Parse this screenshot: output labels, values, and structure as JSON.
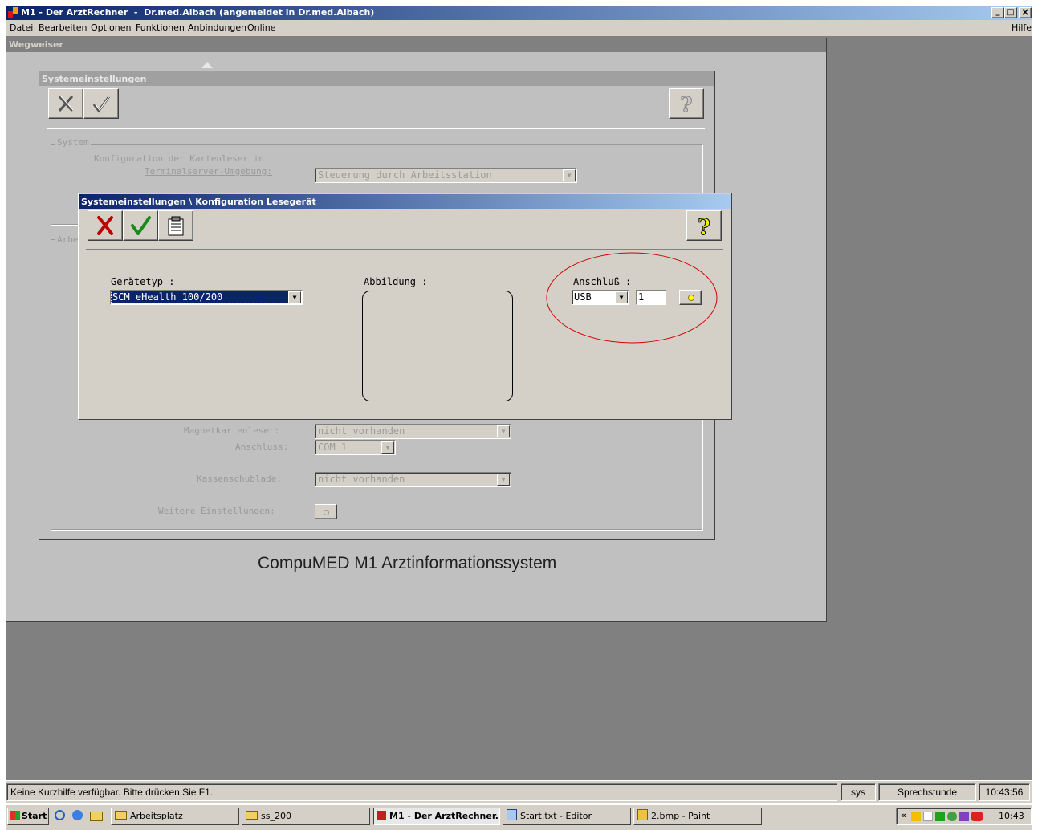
{
  "window": {
    "title": "M1 - Der ArztRechner  -  Dr.med.Albach (angemeldet in Dr.med.Albach)",
    "controls": {
      "minimize": "_",
      "maximize": "□",
      "close": "×"
    }
  },
  "menu": {
    "items": [
      "Datei",
      "Bearbeiten",
      "Optionen",
      "Funktionen",
      "Anbindungen",
      "Online"
    ],
    "help": "Hilfe"
  },
  "wegweiser": {
    "title": "Wegweiser",
    "footer": "CompuMED M1 Arztinformationssystem"
  },
  "system_settings": {
    "title": "Systemeinstellungen",
    "system_group": "System",
    "kartenleser_label_1": "Konfiguration der Kartenleser in",
    "kartenleser_label_2": "Terminalserver-Umgebung:",
    "kartenleser_value": "Steuerung durch Arbeitsstation",
    "arbeitsplatz_group": "Arbe",
    "magnet_label": "Magnetkartenleser:",
    "magnet_value": "nicht vorhanden",
    "anschluss_label": "Anschluss:",
    "anschluss_value": "COM 1",
    "kasse_label": "Kassenschublade:",
    "kasse_value": "nicht vorhanden",
    "weitere_label": "Weitere Einstellungen:"
  },
  "reader_dialog": {
    "title": "Systemeinstellungen \\ Konfiguration Lesegerät",
    "geraetetyp_label": "Gerätetyp :",
    "geraetetyp_value": "SCM eHealth 100/200",
    "abbildung_label": "Abbildung :",
    "anschluss_label": "Anschluß :",
    "anschluss_value": "USB",
    "port_value": "1"
  },
  "statusbar": {
    "hint": "Keine Kurzhilfe verfügbar. Bitte drücken Sie F1.",
    "user": "sys",
    "mode": "Sprechstunde",
    "time": "10:43:56"
  },
  "taskbar": {
    "start": "Start",
    "tasks": [
      "Arbeitsplatz",
      "ss_200",
      "M1 - Der ArztRechner...",
      "Start.txt - Editor",
      "2.bmp - Paint"
    ],
    "clock": "10:43",
    "tray_chevron": "«"
  },
  "icons": {
    "cancel": "x-icon",
    "ok": "check-icon",
    "help": "question-icon",
    "clipboard": "clipboard-icon"
  },
  "colors": {
    "title_start": "#0a246a",
    "title_end": "#a6caf0",
    "face": "#d4d0c8",
    "desktop": "#808080",
    "annotation": "#d40000"
  }
}
